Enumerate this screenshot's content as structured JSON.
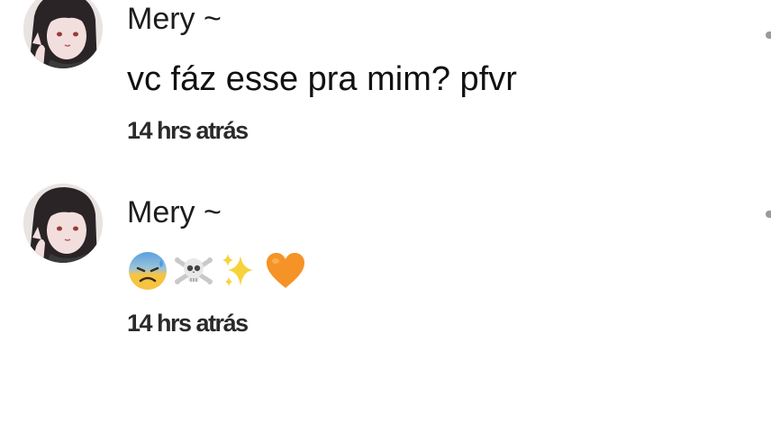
{
  "comments": [
    {
      "author": "Mery ~",
      "text": "vc fáz esse pra mim? pfvr",
      "timestamp": "14 hrs atrás",
      "avatar_icon": "avatar-anime-girl"
    },
    {
      "author": "Mery ~",
      "emojis": [
        "anxious-face-with-sweat-emoji",
        "skull-and-crossbones-emoji",
        "sparkles-emoji",
        "orange-heart-emoji"
      ],
      "timestamp": "14 hrs atrás",
      "avatar_icon": "avatar-anime-girl"
    }
  ],
  "colors": {
    "background": "#ffffff",
    "text": "#111111",
    "orange_heart": "#f59326",
    "anxious_face": "#f6c443",
    "anxious_face_top": "#5aa0df"
  }
}
